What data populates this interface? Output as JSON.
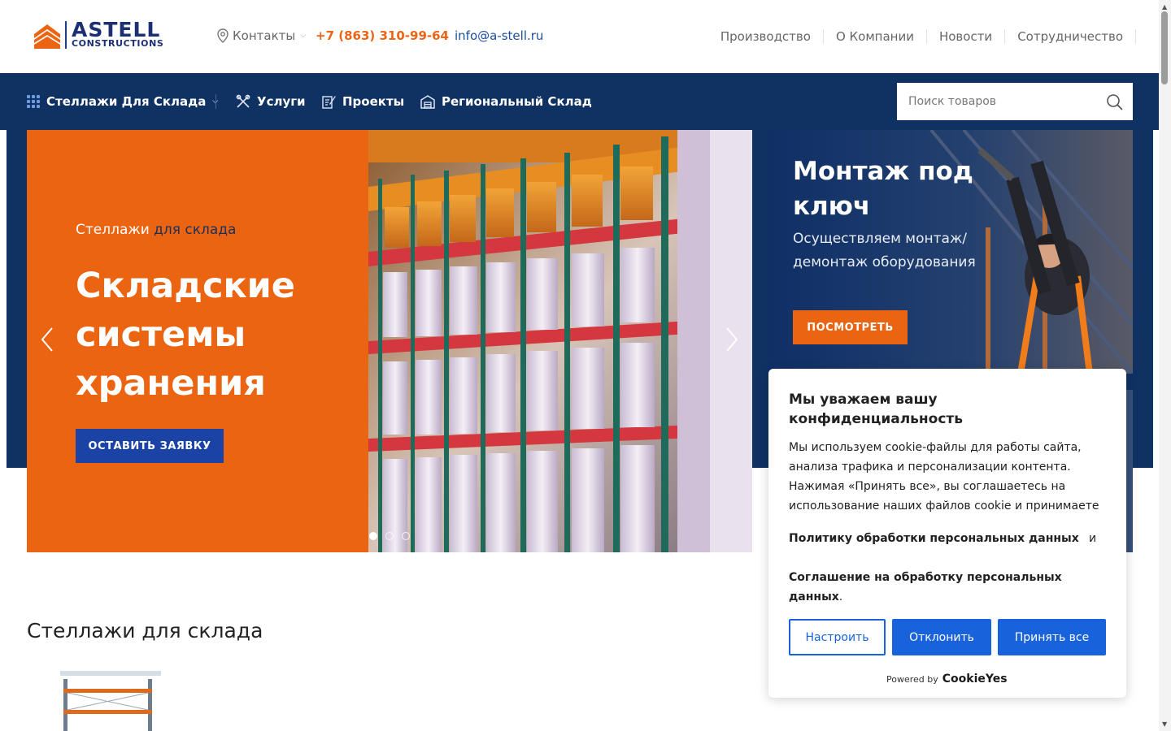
{
  "header": {
    "logo_name": "ASTELL",
    "logo_sub": "CONSTRUCTIONS",
    "contacts_label": "Контакты",
    "phone": "+7 (863) 310-99-64",
    "email": "info@a-stell.ru",
    "nav": [
      "Производство",
      "О Компании",
      "Новости",
      "Сотрудничество"
    ]
  },
  "mainnav": {
    "catalog_label": "Стеллажи Для Склада",
    "items": [
      "Услуги",
      "Проекты",
      "Региональный Склад"
    ],
    "search_placeholder": "Поиск товаров"
  },
  "hero": {
    "kicker_prefix": "Стеллажи ",
    "kicker_accent": "для склада",
    "title": "Складские системы хранения",
    "cta": "ОСТАВИТЬ ЗАЯВКУ",
    "slide_count": 3,
    "active_slide": 1
  },
  "side_banner": {
    "title": "Монтаж под ключ",
    "description": "Осуществляем монтаж/демонтаж оборудования",
    "button": "ПОСМОТРЕТЬ"
  },
  "section": {
    "title": "Стеллажи для склада"
  },
  "cookie": {
    "title": "Мы уважаем вашу конфиденциальность",
    "text": "Мы используем cookie-файлы для работы сайта, анализа трафика и персонализации контента. Нажимая «Принять все», вы соглашаетесь на использование наших файлов cookie и принимаете",
    "policy_link": "Политику обработки персональных данных",
    "and": "и",
    "agreement_link": "Соглашение на обработку персональных данных",
    "period": ".",
    "btn_customize": "Настроить",
    "btn_reject": "Отклонить",
    "btn_accept": "Принять все",
    "powered_by": "Powered by",
    "powered_brand": "CookieYes"
  },
  "colors": {
    "brand_orange": "#eb6411",
    "brand_navy": "#0f3263",
    "cookie_blue": "#1863dc"
  }
}
